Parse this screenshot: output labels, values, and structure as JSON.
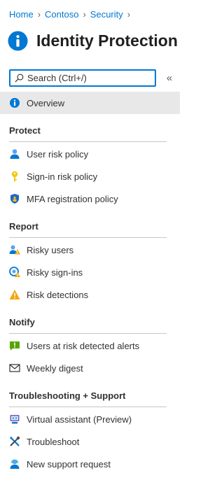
{
  "breadcrumb": [
    "Home",
    "Contoso",
    "Security"
  ],
  "title": "Identity Protection",
  "search": {
    "placeholder": "Search (Ctrl+/)"
  },
  "collapse_glyph": "«",
  "overview": {
    "label": "Overview",
    "icon": "info-icon"
  },
  "sections": [
    {
      "header": "Protect",
      "items": [
        {
          "label": "User risk policy",
          "icon": "user-icon"
        },
        {
          "label": "Sign-in risk policy",
          "icon": "key-icon"
        },
        {
          "label": "MFA registration policy",
          "icon": "shield-icon"
        }
      ]
    },
    {
      "header": "Report",
      "items": [
        {
          "label": "Risky users",
          "icon": "risky-users-icon"
        },
        {
          "label": "Risky sign-ins",
          "icon": "risky-signins-icon"
        },
        {
          "label": "Risk detections",
          "icon": "warning-icon"
        }
      ]
    },
    {
      "header": "Notify",
      "items": [
        {
          "label": "Users at risk detected alerts",
          "icon": "alert-message-icon"
        },
        {
          "label": "Weekly digest",
          "icon": "mail-icon"
        }
      ]
    },
    {
      "header": "Troubleshooting + Support",
      "items": [
        {
          "label": "Virtual assistant (Preview)",
          "icon": "virtual-assistant-icon"
        },
        {
          "label": "Troubleshoot",
          "icon": "tools-icon"
        },
        {
          "label": "New support request",
          "icon": "support-person-icon"
        }
      ]
    }
  ],
  "colors": {
    "accent": "#0078d4",
    "selected_bg": "#e8e8e8",
    "divider": "#c8c6c4"
  }
}
